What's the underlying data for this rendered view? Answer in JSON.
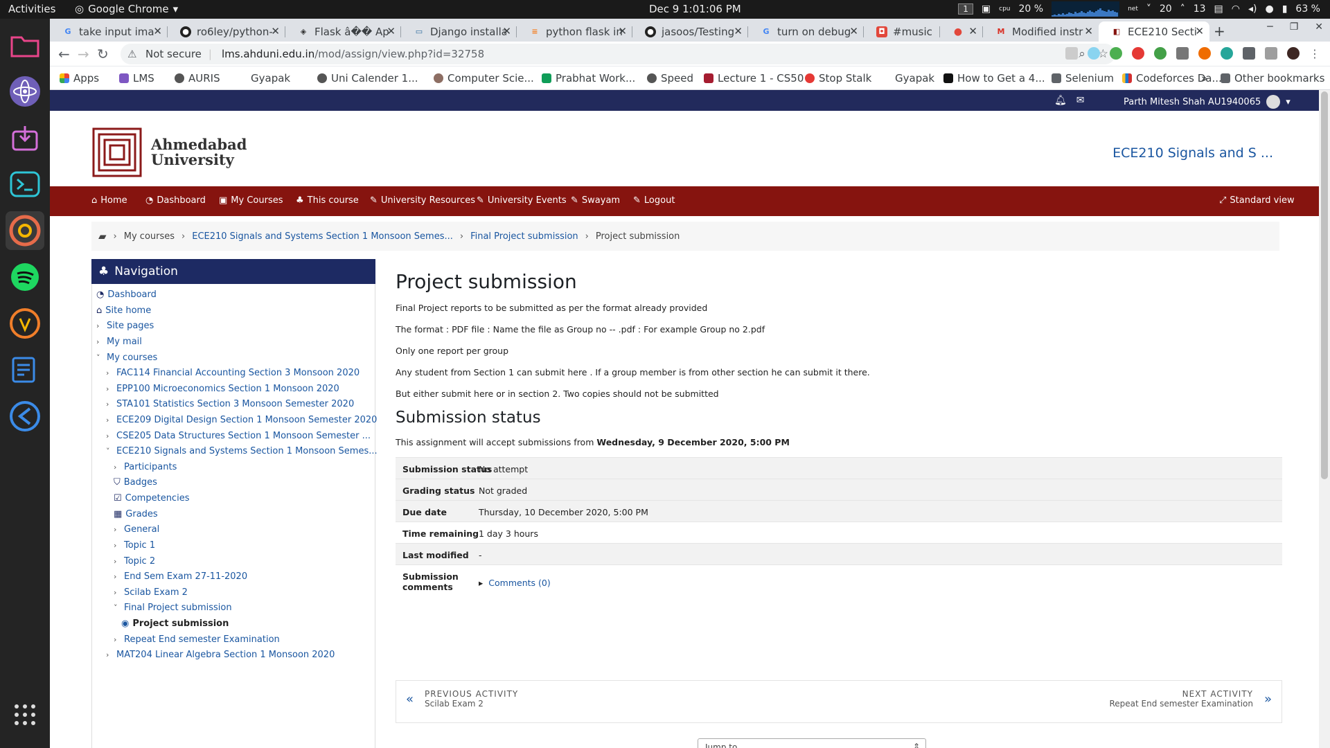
{
  "topbar": {
    "activities": "Activities",
    "app": "Google Chrome",
    "clock": "Dec 9  1:01:06 PM",
    "workspace": "1",
    "cpu_label": "cpu",
    "cpu": "20 %",
    "net_label": "net",
    "net_down": "20",
    "net_up": "13",
    "battery": "63 %"
  },
  "tabs": [
    {
      "title": "take input ima",
      "icon": "google-icon"
    },
    {
      "title": "ro6ley/python-",
      "icon": "github-icon"
    },
    {
      "title": "Flask â�� Ap",
      "icon": "flask-icon"
    },
    {
      "title": "Django installa",
      "icon": "book-icon"
    },
    {
      "title": "python flask in",
      "icon": "stackoverflow-icon"
    },
    {
      "title": "jasoos/Testing",
      "icon": "github-icon"
    },
    {
      "title": "turn on debug",
      "icon": "google-icon"
    },
    {
      "title": "#music",
      "icon": "discord-icon"
    },
    {
      "title": "",
      "icon": "recording-icon"
    },
    {
      "title": "Modified instr",
      "icon": "gmail-icon"
    },
    {
      "title": "ECE210 Sectio",
      "icon": "moodle-icon"
    }
  ],
  "address": {
    "not_secure": "Not secure",
    "host": "lms.ahduni.edu.in",
    "path": "/mod/assign/view.php?id=32758"
  },
  "bookmarks": [
    "Apps",
    "LMS",
    "AURIS",
    "Gyapak",
    "Uni Calender 1...",
    "Computer Scie...",
    "Prabhat Work...",
    "Speed",
    "Lecture 1 - CS50",
    "Stop Stalk",
    "Gyapak",
    "How to Get a 4...",
    "Selenium",
    "Codeforces Da...",
    "»",
    "Other bookmarks"
  ],
  "user": {
    "name": "Parth Mitesh Shah AU1940065"
  },
  "logo": {
    "line1": "Ahmedabad",
    "line2": "University"
  },
  "course_header": "ECE210 Signals and S ...",
  "main_nav": [
    "Home",
    "Dashboard",
    "My Courses",
    "This course",
    "University Resources",
    "University Events",
    "Swayam",
    "Logout"
  ],
  "standard_view": "Standard view",
  "breadcrumb": [
    "My courses",
    "ECE210 Signals and Systems Section 1 Monsoon Semes...",
    "Final Project submission",
    "Project submission"
  ],
  "nav": {
    "title": "Navigation",
    "items": [
      "Dashboard",
      "Site home",
      "Site pages",
      "My mail",
      "My courses",
      "FAC114 Financial Accounting Section 3 Monsoon 2020",
      "EPP100 Microeconomics Section 1 Monsoon 2020",
      "STA101 Statistics Section 3 Monsoon Semester 2020",
      "ECE209 Digital Design Section 1 Monsoon Semester 2020",
      "CSE205 Data Structures Section 1 Monsoon Semester ...",
      "ECE210 Signals and Systems Section 1 Monsoon Semes...",
      "Participants",
      "Badges",
      "Competencies",
      "Grades",
      "General",
      "Topic 1",
      "Topic 2",
      "End Sem Exam 27-11-2020",
      "Scilab Exam 2",
      "Final Project submission",
      "Project submission",
      "Repeat End semester Examination",
      "MAT204 Linear Algebra Section 1 Monsoon 2020"
    ]
  },
  "content": {
    "title": "Project submission",
    "paras": [
      "Final Project reports to be submitted as per the format already provided",
      "The format : PDF file :  Name the file as  Group no -- .pdf : For example Group no 2.pdf",
      "Only one report per group",
      "Any student from Section 1 can submit here . If a group member is from other section he can submit it there.",
      "But either submit here or in section 2. Two copies should not be submitted"
    ],
    "status_title": "Submission status",
    "accept_prefix": "This assignment will accept submissions from ",
    "accept_date": "Wednesday, 9 December 2020, 5:00 PM",
    "rows": [
      [
        "Submission status",
        "No attempt"
      ],
      [
        "Grading status",
        "Not graded"
      ],
      [
        "Due date",
        "Thursday, 10 December 2020, 5:00 PM"
      ],
      [
        "Time remaining",
        "1 day 3 hours"
      ],
      [
        "Last modified",
        "-"
      ],
      [
        "Submission comments",
        "Comments (0)"
      ]
    ]
  },
  "activity_nav": {
    "prev_label": "PREVIOUS ACTIVITY",
    "prev_name": "Scilab Exam 2",
    "next_label": "NEXT ACTIVITY",
    "next_name": "Repeat End semester Examination"
  },
  "jump": "Jump to..."
}
